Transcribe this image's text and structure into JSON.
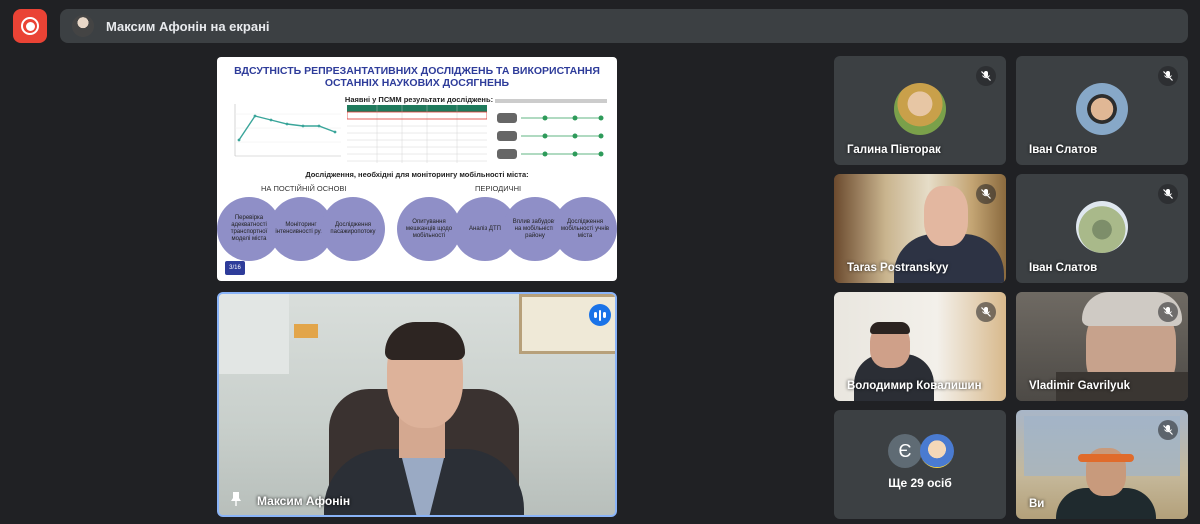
{
  "presenter": {
    "text": "Максим Афонін на екрані"
  },
  "slide": {
    "title_line1": "ВДСУТНІСТЬ РЕПРЕЗАНТАТИВНИХ ДОСЛІДЖЕНЬ ТА ВИКОРИСТАННЯ",
    "title_line2": "ОСТАННІХ НАУКОВИХ ДОСЯГНЕНЬ",
    "table_title": "Наявні у ПСММ результати досліджень:",
    "subtitle": "Дослідження, необхідні для моніторингу мобільності міста:",
    "group_left": "НА ПОСТІЙНІЙ ОСНОВІ",
    "group_right": "ПЕРІОДИЧНІ",
    "circles": [
      "Перевірка адекватності транспортної моделі міста",
      "Моніторинг інтенсивності руху",
      "Дослідження пасажиропотоку",
      "Опитування мешканців щодо мобільності",
      "Аналіз ДТП",
      "Вплив забудови на мобільність району",
      "Дослідження мобільності учнів міста"
    ],
    "page": "3/16"
  },
  "main_video": {
    "name": "Максим Афонін"
  },
  "tiles": [
    {
      "name": "Галина Півторак"
    },
    {
      "name": "Іван Слатов"
    },
    {
      "name": "Taras Postranskyy"
    },
    {
      "name": "Іван Слатов"
    },
    {
      "name": "Володимир Ковалишин"
    },
    {
      "name": "Vladimir Gavrilyuk"
    },
    {
      "name": "Ще 29 осіб",
      "initial": "Є"
    },
    {
      "name": "Ви"
    }
  ],
  "colors": {
    "accent": "#8ab4f8",
    "record": "#ea4335",
    "background": "#202124",
    "tile": "#3c4043"
  }
}
